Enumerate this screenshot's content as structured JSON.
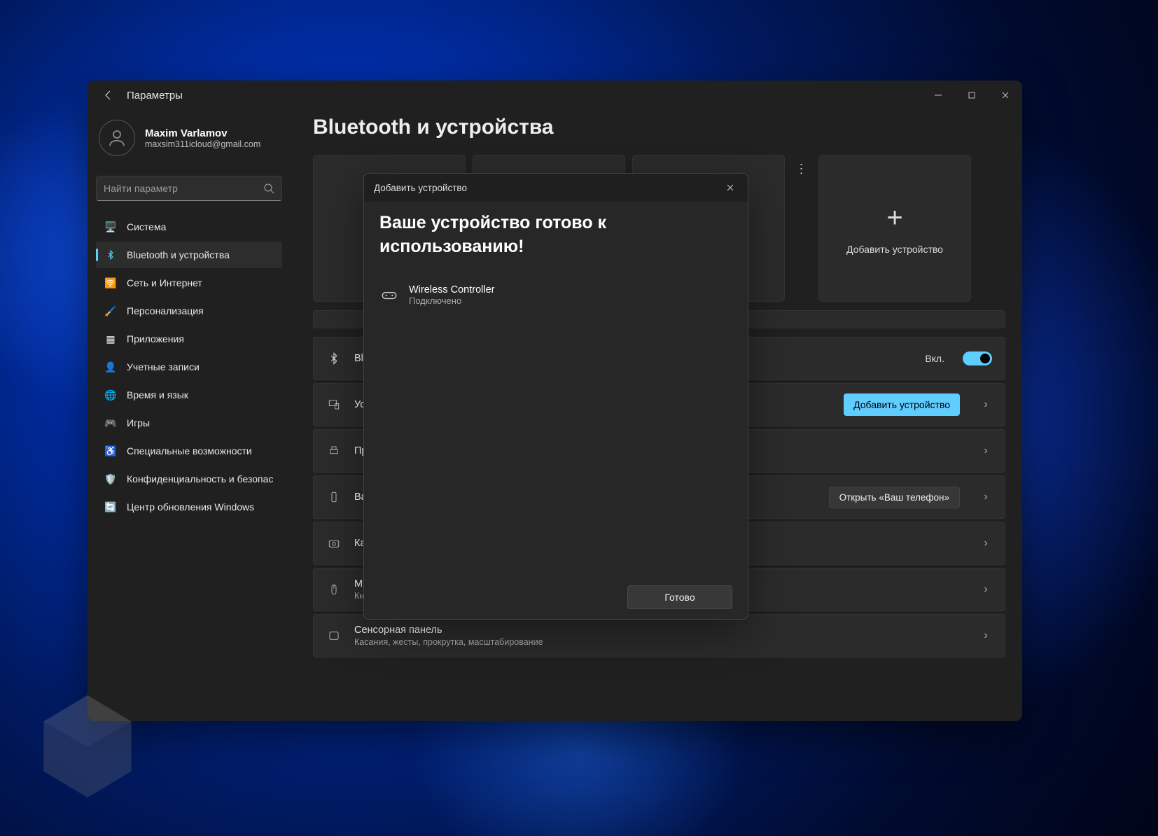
{
  "window": {
    "title": "Параметры"
  },
  "profile": {
    "name": "Maxim Varlamov",
    "email": "maxsim311icloud@gmail.com"
  },
  "search": {
    "placeholder": "Найти параметр"
  },
  "nav": [
    {
      "icon": "🖥️",
      "label": "Система",
      "id": "system",
      "active": false
    },
    {
      "icon": "bt",
      "label": "Bluetooth и устройства",
      "id": "bluetooth",
      "active": true
    },
    {
      "icon": "🛜",
      "label": "Сеть и Интернет",
      "id": "network",
      "active": false
    },
    {
      "icon": "🖌️",
      "label": "Персонализация",
      "id": "personalization",
      "active": false
    },
    {
      "icon": "▦",
      "label": "Приложения",
      "id": "apps",
      "active": false
    },
    {
      "icon": "👤",
      "label": "Учетные записи",
      "id": "accounts",
      "active": false
    },
    {
      "icon": "🌐",
      "label": "Время и язык",
      "id": "time",
      "active": false
    },
    {
      "icon": "🎮",
      "label": "Игры",
      "id": "gaming",
      "active": false
    },
    {
      "icon": "♿",
      "label": "Специальные возможности",
      "id": "accessibility",
      "active": false
    },
    {
      "icon": "🛡️",
      "label": "Конфиденциальность и безопас",
      "id": "privacy",
      "active": false
    },
    {
      "icon": "🔄",
      "label": "Центр обновления Windows",
      "id": "update",
      "active": false
    }
  ],
  "page": {
    "title": "Bluetooth и устройства",
    "add_device_card": "Добавить устройство",
    "rows": {
      "bluetooth": {
        "title": "Bluetooth",
        "sub": "",
        "toggle_label": "Вкл."
      },
      "devices": {
        "title": "Устройства",
        "sub": "",
        "button": "Добавить устройство"
      },
      "printers": {
        "title": "Принтеры",
        "sub": ""
      },
      "phone": {
        "title": "Ваш телефон",
        "sub": "",
        "button": "Открыть «Ваш телефон»"
      },
      "cameras": {
        "title": "Камеры",
        "sub": ""
      },
      "mouse": {
        "title": "Мышь",
        "sub": "Кнопки, скорость указателя мыши, прокрутка"
      },
      "touchpad": {
        "title": "Сенсорная панель",
        "sub": "Касания, жесты, прокрутка, масштабирование"
      }
    }
  },
  "dialog": {
    "header": "Добавить устройство",
    "title": "Ваше устройство готово к использованию!",
    "device": {
      "name": "Wireless Controller",
      "status": "Подключено"
    },
    "done": "Готово"
  }
}
